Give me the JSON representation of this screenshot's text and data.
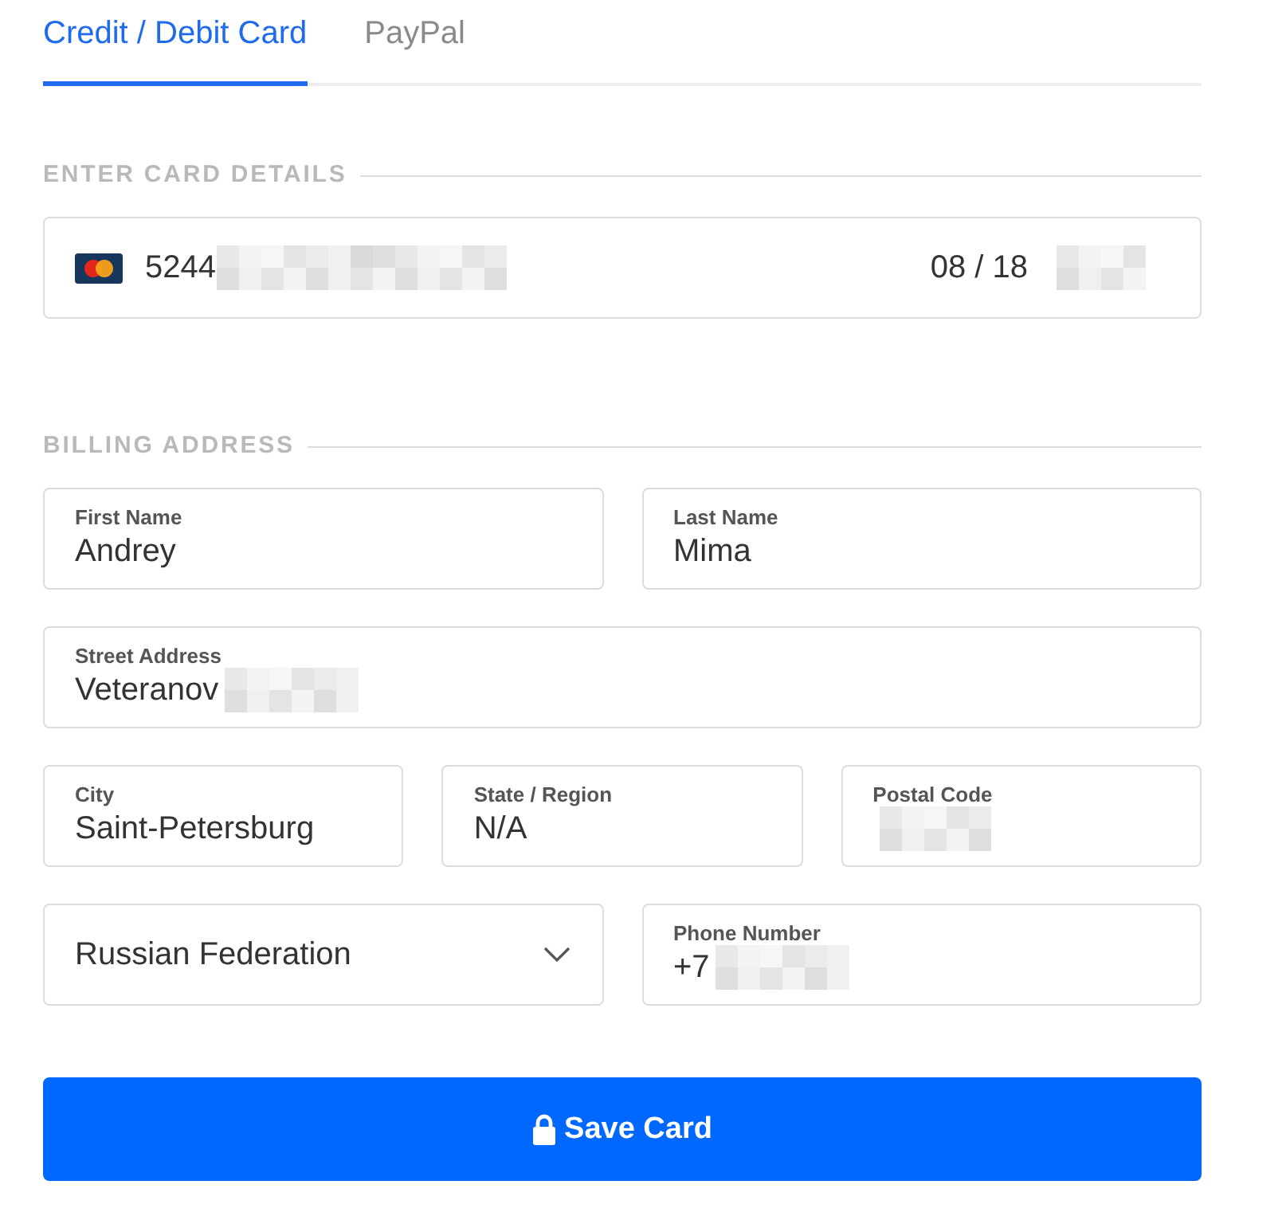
{
  "tabs": [
    {
      "label": "Credit / Debit Card",
      "selected": true
    },
    {
      "label": "PayPal",
      "selected": false
    }
  ],
  "card_section": {
    "heading": "ENTER CARD DETAILS",
    "card_field": {
      "number": "5244",
      "number_redacted": true,
      "expiry": "08 / 18",
      "cvc_redacted": true
    }
  },
  "billing_section": {
    "heading": "BILLING ADDRESS",
    "rows": [
      {
        "fields": [
          {
            "kind": "text",
            "label": "First Name",
            "value": "Andrey",
            "redacted": false
          },
          {
            "kind": "text",
            "label": "Last Name",
            "value": "Mima",
            "redacted": false
          }
        ]
      },
      {
        "fields": [
          {
            "kind": "text",
            "label": "Street Address",
            "value": "Veteranov",
            "redacted": true
          }
        ]
      },
      {
        "fields": [
          {
            "kind": "text",
            "label": "City",
            "value": "Saint-Petersburg",
            "redacted": false
          },
          {
            "kind": "text",
            "label": "State / Region",
            "value": "N/A",
            "redacted": false
          },
          {
            "kind": "text",
            "label": "Postal Code",
            "redacted": true
          }
        ]
      },
      {
        "fields": [
          {
            "kind": "select",
            "value": "Russian Federation"
          },
          {
            "kind": "text",
            "label": "Phone Number",
            "value": "+7",
            "redacted": true
          }
        ]
      }
    ]
  },
  "save_button": {
    "label": "Save Card"
  }
}
